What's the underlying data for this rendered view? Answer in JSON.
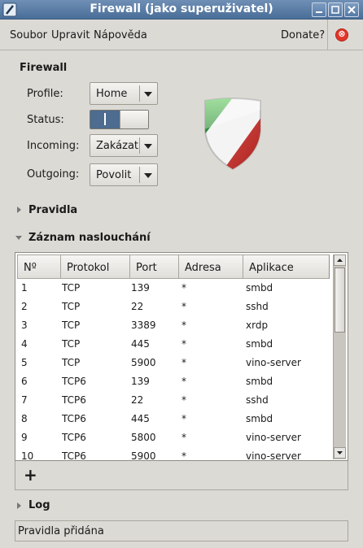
{
  "window": {
    "title": "Firewall (jako superuživatel)"
  },
  "menu": {
    "items": [
      "Soubor",
      "Upravit",
      "Nápověda"
    ],
    "donate": "Donate?"
  },
  "firewall": {
    "heading": "Firewall",
    "profile_label": "Profile:",
    "profile_value": "Home",
    "status_label": "Status:",
    "status_on": true,
    "incoming_label": "Incoming:",
    "incoming_value": "Zakázat",
    "outgoing_label": "Outgoing:",
    "outgoing_value": "Povolit"
  },
  "sections": {
    "rules": "Pravidla",
    "listening": "Záznam naslouchání",
    "log": "Log"
  },
  "table": {
    "columns": [
      "Nº",
      "Protokol",
      "Port",
      "Adresa",
      "Aplikace"
    ],
    "rows": [
      [
        "1",
        "TCP",
        "139",
        "*",
        "smbd"
      ],
      [
        "2",
        "TCP",
        "22",
        "*",
        "sshd"
      ],
      [
        "3",
        "TCP",
        "3389",
        "*",
        "xrdp"
      ],
      [
        "4",
        "TCP",
        "445",
        "*",
        "smbd"
      ],
      [
        "5",
        "TCP",
        "5900",
        "*",
        "vino-server"
      ],
      [
        "6",
        "TCP6",
        "139",
        "*",
        "smbd"
      ],
      [
        "7",
        "TCP6",
        "22",
        "*",
        "sshd"
      ],
      [
        "8",
        "TCP6",
        "445",
        "*",
        "smbd"
      ],
      [
        "9",
        "TCP6",
        "5800",
        "*",
        "vino-server"
      ],
      [
        "10",
        "TCP6",
        "5900",
        "*",
        "vino-server"
      ]
    ]
  },
  "add_button": "+",
  "status_text": "Pravidla přidána",
  "colors": {
    "titlebar": "#5a7ea8",
    "switch_on": "#4d6c8f",
    "shield_green": "#2e8b3a",
    "shield_red": "#c0302a"
  }
}
